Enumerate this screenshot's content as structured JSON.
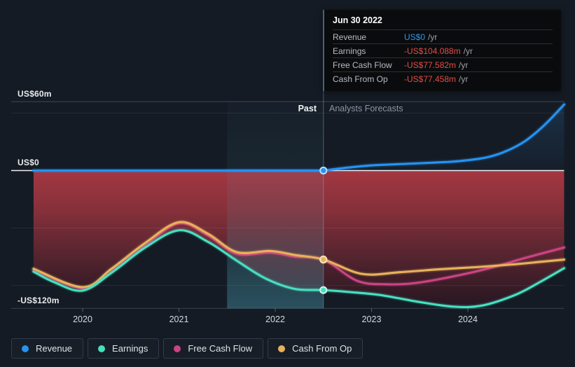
{
  "tooltip": {
    "date": "Jun 30 2022",
    "rows": [
      {
        "label": "Revenue",
        "value": "US$0",
        "suffix": "/yr",
        "color": "#3095ea"
      },
      {
        "label": "Earnings",
        "value": "-US$104.088m",
        "suffix": "/yr",
        "color": "#df4f47"
      },
      {
        "label": "Free Cash Flow",
        "value": "-US$77.582m",
        "suffix": "/yr",
        "color": "#df4f47"
      },
      {
        "label": "Cash From Op",
        "value": "-US$77.458m",
        "suffix": "/yr",
        "color": "#df4f47"
      }
    ]
  },
  "sections": {
    "past": "Past",
    "forecast": "Analysts Forecasts"
  },
  "axes": {
    "y_labels": [
      {
        "text": "US$60m",
        "value": 60
      },
      {
        "text": "US$0",
        "value": 0
      },
      {
        "text": "-US$120m",
        "value": -120
      }
    ],
    "x_labels": [
      {
        "text": "2020",
        "value": 2020
      },
      {
        "text": "2021",
        "value": 2021
      },
      {
        "text": "2022",
        "value": 2022
      },
      {
        "text": "2023",
        "value": 2023
      },
      {
        "text": "2024",
        "value": 2024
      }
    ]
  },
  "legend": [
    {
      "label": "Revenue",
      "color": "#2493f2"
    },
    {
      "label": "Earnings",
      "color": "#46e0c0"
    },
    {
      "label": "Free Cash Flow",
      "color": "#cb4384"
    },
    {
      "label": "Cash From Op",
      "color": "#e7b259"
    }
  ],
  "chart_data": {
    "type": "line",
    "unit": "US$ millions per year",
    "x_axis": {
      "range": [
        2019.49,
        2025
      ],
      "ticks": [
        2020,
        2021,
        2022,
        2023,
        2024
      ]
    },
    "y_axis": {
      "range": [
        -121,
        61
      ],
      "labeled_ticks": [
        60,
        0,
        -120
      ],
      "minor_gridlines": [
        50,
        -50,
        -100
      ]
    },
    "divider_x": 2022.5,
    "divider_date": "Jun 30 2022",
    "highlight_band_x": [
      2021.5,
      2022.5
    ],
    "series": [
      {
        "name": "Revenue",
        "color": "#2493f2",
        "marker_value": 0,
        "past": [
          [
            2019.49,
            0
          ],
          [
            2020,
            0
          ],
          [
            2021,
            0
          ],
          [
            2022,
            0
          ],
          [
            2022.5,
            0
          ]
        ],
        "forecast": [
          [
            2022.5,
            0
          ],
          [
            2022.75,
            2.5
          ],
          [
            2023,
            4.5
          ],
          [
            2023.4,
            6
          ],
          [
            2023.8,
            7.5
          ],
          [
            2024,
            9
          ],
          [
            2024.2,
            11.5
          ],
          [
            2024.4,
            17
          ],
          [
            2024.6,
            26
          ],
          [
            2024.8,
            40
          ],
          [
            2025,
            57.5
          ]
        ]
      },
      {
        "name": "Earnings",
        "color": "#46e0c0",
        "marker_value": -104.088,
        "past": [
          [
            2019.49,
            -88
          ],
          [
            2019.7,
            -97
          ],
          [
            2020,
            -104.5
          ],
          [
            2020.3,
            -89
          ],
          [
            2020.65,
            -67
          ],
          [
            2021,
            -52
          ],
          [
            2021.3,
            -62
          ],
          [
            2021.6,
            -78.5
          ],
          [
            2021.9,
            -94
          ],
          [
            2022.2,
            -103
          ],
          [
            2022.5,
            -104.088
          ]
        ],
        "forecast": [
          [
            2022.8,
            -106
          ],
          [
            2023.1,
            -108.5
          ],
          [
            2023.5,
            -114.5
          ],
          [
            2023.85,
            -118.5
          ],
          [
            2024.15,
            -117.5
          ],
          [
            2024.5,
            -108
          ],
          [
            2024.75,
            -97
          ],
          [
            2025,
            -85
          ]
        ]
      },
      {
        "name": "Free Cash Flow",
        "color": "#cb4384",
        "marker_value": -77.582,
        "past": [
          [
            2019.49,
            -86.5
          ],
          [
            2020,
            -102.5
          ],
          [
            2020.3,
            -87
          ],
          [
            2020.65,
            -65
          ],
          [
            2021,
            -46
          ],
          [
            2021.3,
            -56.5
          ],
          [
            2021.6,
            -72.5
          ],
          [
            2021.95,
            -71.5
          ],
          [
            2022.2,
            -75
          ],
          [
            2022.5,
            -77.582
          ]
        ],
        "forecast": [
          [
            2022.85,
            -96
          ],
          [
            2023.15,
            -99
          ],
          [
            2023.45,
            -98
          ],
          [
            2023.8,
            -93
          ],
          [
            2024.2,
            -85.5
          ],
          [
            2024.6,
            -76
          ],
          [
            2025,
            -67
          ]
        ]
      },
      {
        "name": "Cash From Op",
        "color": "#e7b259",
        "marker_value": -77.458,
        "past": [
          [
            2019.49,
            -85.5
          ],
          [
            2020,
            -101.5
          ],
          [
            2020.3,
            -85.5
          ],
          [
            2020.65,
            -63
          ],
          [
            2021,
            -45
          ],
          [
            2021.3,
            -55
          ],
          [
            2021.6,
            -71
          ],
          [
            2021.95,
            -70
          ],
          [
            2022.2,
            -73.5
          ],
          [
            2022.5,
            -77.458
          ]
        ],
        "forecast": [
          [
            2022.9,
            -90
          ],
          [
            2023.3,
            -88.5
          ],
          [
            2023.7,
            -86
          ],
          [
            2024.1,
            -84
          ],
          [
            2024.5,
            -81.5
          ],
          [
            2024.75,
            -79.5
          ],
          [
            2025,
            -77.5
          ]
        ]
      }
    ]
  }
}
